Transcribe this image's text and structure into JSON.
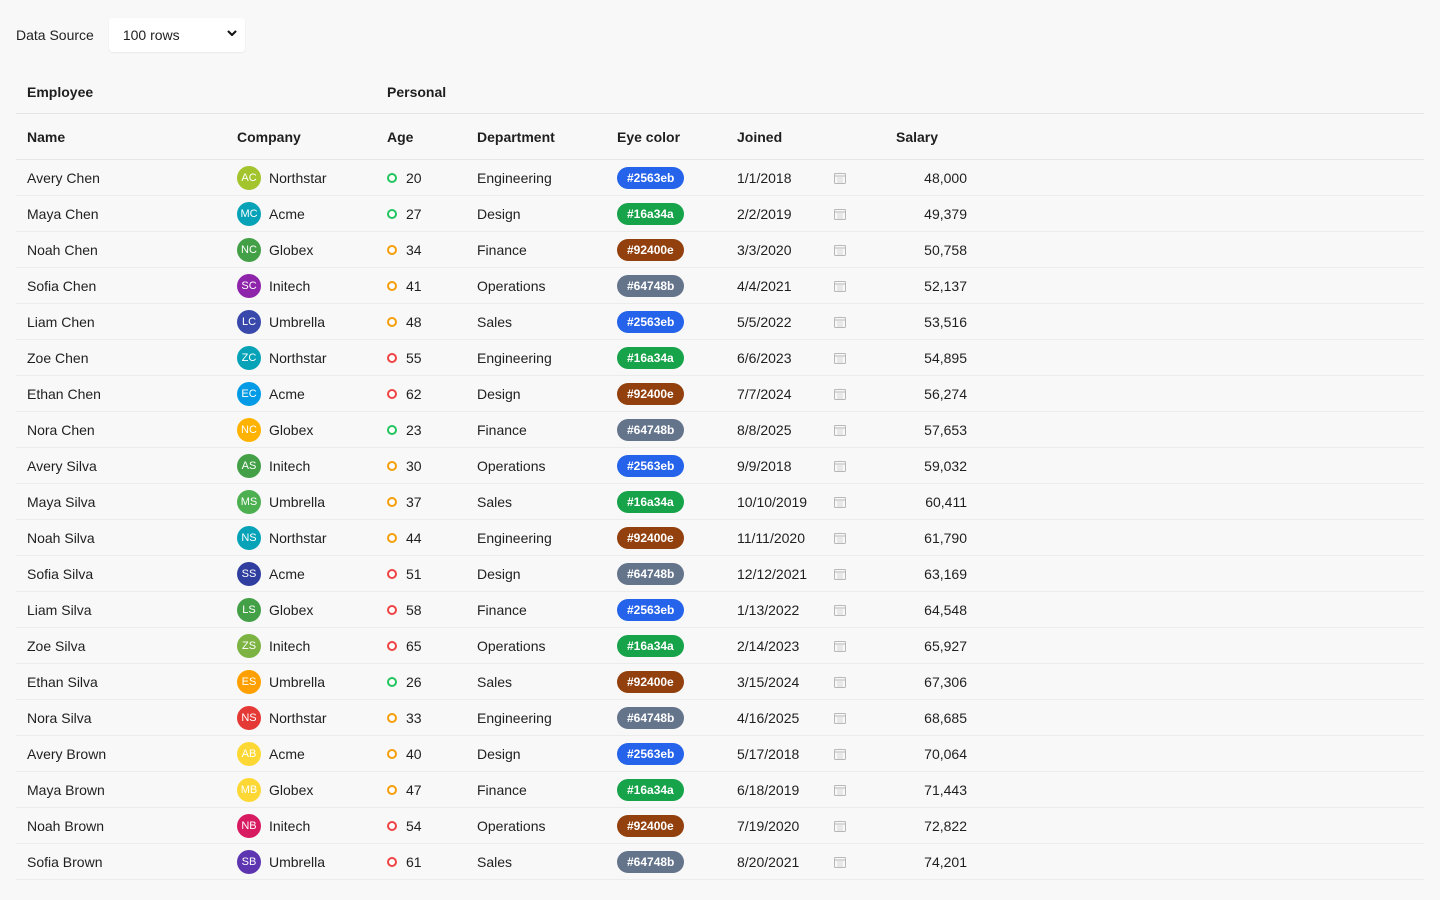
{
  "toolbar": {
    "label": "Data Source",
    "select_value": "100 rows"
  },
  "grid": {
    "group_headers": {
      "employee": "Employee",
      "personal": "Personal"
    },
    "columns": {
      "name": "Name",
      "company": "Company",
      "age": "Age",
      "department": "Department",
      "eye_color": "Eye color",
      "joined": "Joined",
      "salary": "Salary"
    },
    "age_status_colors": {
      "green": "#22c55e",
      "orange": "#f59e0b",
      "red": "#ef4444"
    },
    "icons": {
      "date": "calendar-icon",
      "select": "chevron-down-icon"
    },
    "rows": [
      {
        "name": "Avery Chen",
        "initials": "AC",
        "avatar_color": "#a3c42d",
        "company": "Northstar",
        "age": "20",
        "age_status": "green",
        "department": "Engineering",
        "eye_color": "#2563eb",
        "joined": "1/1/2018",
        "salary": "48,000"
      },
      {
        "name": "Maya Chen",
        "initials": "MC",
        "avatar_color": "#06a3b8",
        "company": "Acme",
        "age": "27",
        "age_status": "green",
        "department": "Design",
        "eye_color": "#16a34a",
        "joined": "2/2/2019",
        "salary": "49,379"
      },
      {
        "name": "Noah Chen",
        "initials": "NC",
        "avatar_color": "#43a047",
        "company": "Globex",
        "age": "34",
        "age_status": "orange",
        "department": "Finance",
        "eye_color": "#92400e",
        "joined": "3/3/2020",
        "salary": "50,758"
      },
      {
        "name": "Sofia Chen",
        "initials": "SC",
        "avatar_color": "#8e24aa",
        "company": "Initech",
        "age": "41",
        "age_status": "orange",
        "department": "Operations",
        "eye_color": "#64748b",
        "joined": "4/4/2021",
        "salary": "52,137"
      },
      {
        "name": "Liam Chen",
        "initials": "LC",
        "avatar_color": "#3949ab",
        "company": "Umbrella",
        "age": "48",
        "age_status": "orange",
        "department": "Sales",
        "eye_color": "#2563eb",
        "joined": "5/5/2022",
        "salary": "53,516"
      },
      {
        "name": "Zoe Chen",
        "initials": "ZC",
        "avatar_color": "#06a3b8",
        "company": "Northstar",
        "age": "55",
        "age_status": "red",
        "department": "Engineering",
        "eye_color": "#16a34a",
        "joined": "6/6/2023",
        "salary": "54,895"
      },
      {
        "name": "Ethan Chen",
        "initials": "EC",
        "avatar_color": "#039be5",
        "company": "Acme",
        "age": "62",
        "age_status": "red",
        "department": "Design",
        "eye_color": "#92400e",
        "joined": "7/7/2024",
        "salary": "56,274"
      },
      {
        "name": "Nora Chen",
        "initials": "NC",
        "avatar_color": "#ffb300",
        "company": "Globex",
        "age": "23",
        "age_status": "green",
        "department": "Finance",
        "eye_color": "#64748b",
        "joined": "8/8/2025",
        "salary": "57,653"
      },
      {
        "name": "Avery Silva",
        "initials": "AS",
        "avatar_color": "#43a047",
        "company": "Initech",
        "age": "30",
        "age_status": "orange",
        "department": "Operations",
        "eye_color": "#2563eb",
        "joined": "9/9/2018",
        "salary": "59,032"
      },
      {
        "name": "Maya Silva",
        "initials": "MS",
        "avatar_color": "#4caf50",
        "company": "Umbrella",
        "age": "37",
        "age_status": "orange",
        "department": "Sales",
        "eye_color": "#16a34a",
        "joined": "10/10/2019",
        "salary": "60,411"
      },
      {
        "name": "Noah Silva",
        "initials": "NS",
        "avatar_color": "#06a3b8",
        "company": "Northstar",
        "age": "44",
        "age_status": "orange",
        "department": "Engineering",
        "eye_color": "#92400e",
        "joined": "11/11/2020",
        "salary": "61,790"
      },
      {
        "name": "Sofia Silva",
        "initials": "SS",
        "avatar_color": "#303f9f",
        "company": "Acme",
        "age": "51",
        "age_status": "red",
        "department": "Design",
        "eye_color": "#64748b",
        "joined": "12/12/2021",
        "salary": "63,169"
      },
      {
        "name": "Liam Silva",
        "initials": "LS",
        "avatar_color": "#43a047",
        "company": "Globex",
        "age": "58",
        "age_status": "red",
        "department": "Finance",
        "eye_color": "#2563eb",
        "joined": "1/13/2022",
        "salary": "64,548"
      },
      {
        "name": "Zoe Silva",
        "initials": "ZS",
        "avatar_color": "#7cb342",
        "company": "Initech",
        "age": "65",
        "age_status": "red",
        "department": "Operations",
        "eye_color": "#16a34a",
        "joined": "2/14/2023",
        "salary": "65,927"
      },
      {
        "name": "Ethan Silva",
        "initials": "ES",
        "avatar_color": "#ffa000",
        "company": "Umbrella",
        "age": "26",
        "age_status": "green",
        "department": "Sales",
        "eye_color": "#92400e",
        "joined": "3/15/2024",
        "salary": "67,306"
      },
      {
        "name": "Nora Silva",
        "initials": "NS",
        "avatar_color": "#e53935",
        "company": "Northstar",
        "age": "33",
        "age_status": "orange",
        "department": "Engineering",
        "eye_color": "#64748b",
        "joined": "4/16/2025",
        "salary": "68,685"
      },
      {
        "name": "Avery Brown",
        "initials": "AB",
        "avatar_color": "#fdd835",
        "company": "Acme",
        "age": "40",
        "age_status": "orange",
        "department": "Design",
        "eye_color": "#2563eb",
        "joined": "5/17/2018",
        "salary": "70,064"
      },
      {
        "name": "Maya Brown",
        "initials": "MB",
        "avatar_color": "#fdd835",
        "company": "Globex",
        "age": "47",
        "age_status": "orange",
        "department": "Finance",
        "eye_color": "#16a34a",
        "joined": "6/18/2019",
        "salary": "71,443"
      },
      {
        "name": "Noah Brown",
        "initials": "NB",
        "avatar_color": "#d81b60",
        "company": "Initech",
        "age": "54",
        "age_status": "red",
        "department": "Operations",
        "eye_color": "#92400e",
        "joined": "7/19/2020",
        "salary": "72,822"
      },
      {
        "name": "Sofia Brown",
        "initials": "SB",
        "avatar_color": "#5e35b1",
        "company": "Umbrella",
        "age": "61",
        "age_status": "red",
        "department": "Sales",
        "eye_color": "#64748b",
        "joined": "8/20/2021",
        "salary": "74,201"
      }
    ]
  }
}
